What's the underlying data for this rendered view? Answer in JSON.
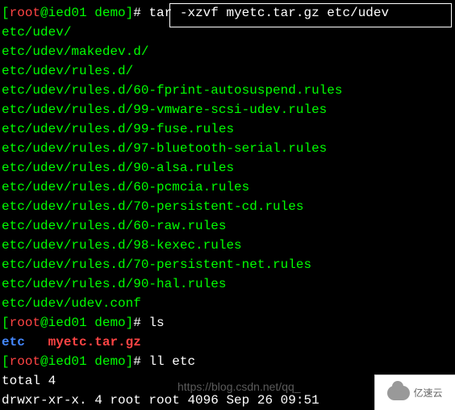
{
  "prompts": {
    "open": "[",
    "user": "root",
    "at": "@",
    "host": "ied01 ",
    "path": "demo",
    "close": "]",
    "hash": "# "
  },
  "commands": {
    "cmd1": "tar -xzvf myetc.tar.gz etc/udev",
    "cmd2": "ls",
    "cmd3": "ll etc"
  },
  "extract_output": [
    "etc/udev/",
    "etc/udev/makedev.d/",
    "etc/udev/rules.d/",
    "etc/udev/rules.d/60-fprint-autosuspend.rules",
    "etc/udev/rules.d/99-vmware-scsi-udev.rules",
    "etc/udev/rules.d/99-fuse.rules",
    "etc/udev/rules.d/97-bluetooth-serial.rules",
    "etc/udev/rules.d/90-alsa.rules",
    "etc/udev/rules.d/60-pcmcia.rules",
    "etc/udev/rules.d/70-persistent-cd.rules",
    "etc/udev/rules.d/60-raw.rules",
    "etc/udev/rules.d/98-kexec.rules",
    "etc/udev/rules.d/70-persistent-net.rules",
    "etc/udev/rules.d/90-hal.rules",
    "etc/udev/udev.conf"
  ],
  "ls_output": {
    "dir": "etc",
    "spacer": "   ",
    "archive": "myetc.tar.gz"
  },
  "ll_output": {
    "total": "total 4",
    "entry": "drwxr-xr-x. 4 root root 4096 Sep 26 09:51 "
  },
  "watermark": {
    "text": "https://blog.csdn.net/qq_",
    "logo": "亿速云"
  }
}
